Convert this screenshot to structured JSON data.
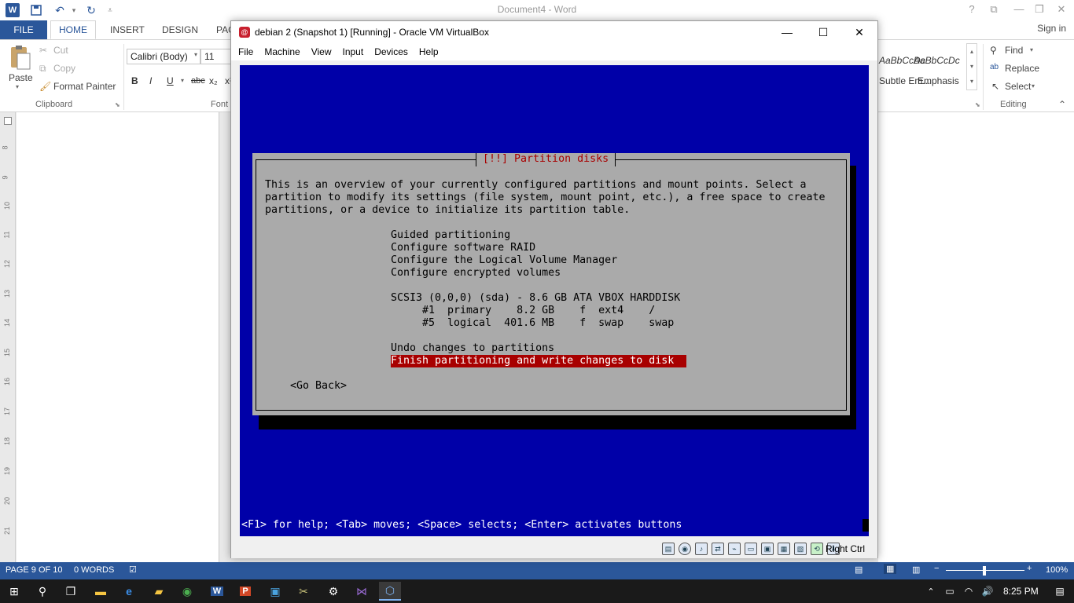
{
  "word": {
    "title": "Document4 - Word",
    "logo": "W",
    "file_tab": "FILE",
    "tabs": [
      "HOME",
      "INSERT",
      "DESIGN",
      "PAG"
    ],
    "signin": "Sign in",
    "clipboard": {
      "paste": "Paste",
      "cut": "Cut",
      "copy": "Copy",
      "format_painter": "Format Painter",
      "group_label": "Clipboard"
    },
    "font": {
      "name": "Calibri (Body)",
      "size": "11",
      "group_label": "Font",
      "buttons": [
        "B",
        "I",
        "U",
        "abc",
        "x₂",
        "x²"
      ]
    },
    "styles": [
      "AaBbCcDc",
      "AaBbCcDc"
    ],
    "style_names": [
      "Subtle Em...",
      "Emphasis"
    ],
    "editing": {
      "find": "Find",
      "replace": "Replace",
      "select": "Select",
      "group_label": "Editing"
    },
    "ruler_numbers": [
      "8",
      "9",
      "10",
      "11",
      "12",
      "13",
      "14",
      "15",
      "16",
      "17",
      "18",
      "19",
      "20",
      "21"
    ],
    "status": {
      "page": "PAGE 9 OF 10",
      "words": "0 WORDS",
      "zoom": "100%"
    }
  },
  "vbox": {
    "title": "debian 2 (Snapshot 1) [Running] - Oracle VM VirtualBox",
    "menu": [
      "File",
      "Machine",
      "View",
      "Input",
      "Devices",
      "Help"
    ],
    "host_key": "Right Ctrl"
  },
  "installer": {
    "title": "[!!] Partition disks",
    "intro": [
      "This is an overview of your currently configured partitions and mount points. Select a",
      "partition to modify its settings (file system, mount point, etc.), a free space to create",
      "partitions, or a device to initialize its partition table."
    ],
    "menu": [
      "Guided partitioning",
      "Configure software RAID",
      "Configure the Logical Volume Manager",
      "Configure encrypted volumes"
    ],
    "disk": "SCSI3 (0,0,0) (sda) - 8.6 GB ATA VBOX HARDDISK",
    "partitions": [
      "#1  primary    8.2 GB    f  ext4    /",
      "#5  logical  401.6 MB    f  swap    swap"
    ],
    "undo": "Undo changes to partitions",
    "finish": "Finish partitioning and write changes to disk  ",
    "go_back": "<Go Back>",
    "help": "<F1> for help; <Tab> moves; <Space> selects; <Enter> activates buttons"
  },
  "taskbar": {
    "time": "8:25 PM"
  }
}
